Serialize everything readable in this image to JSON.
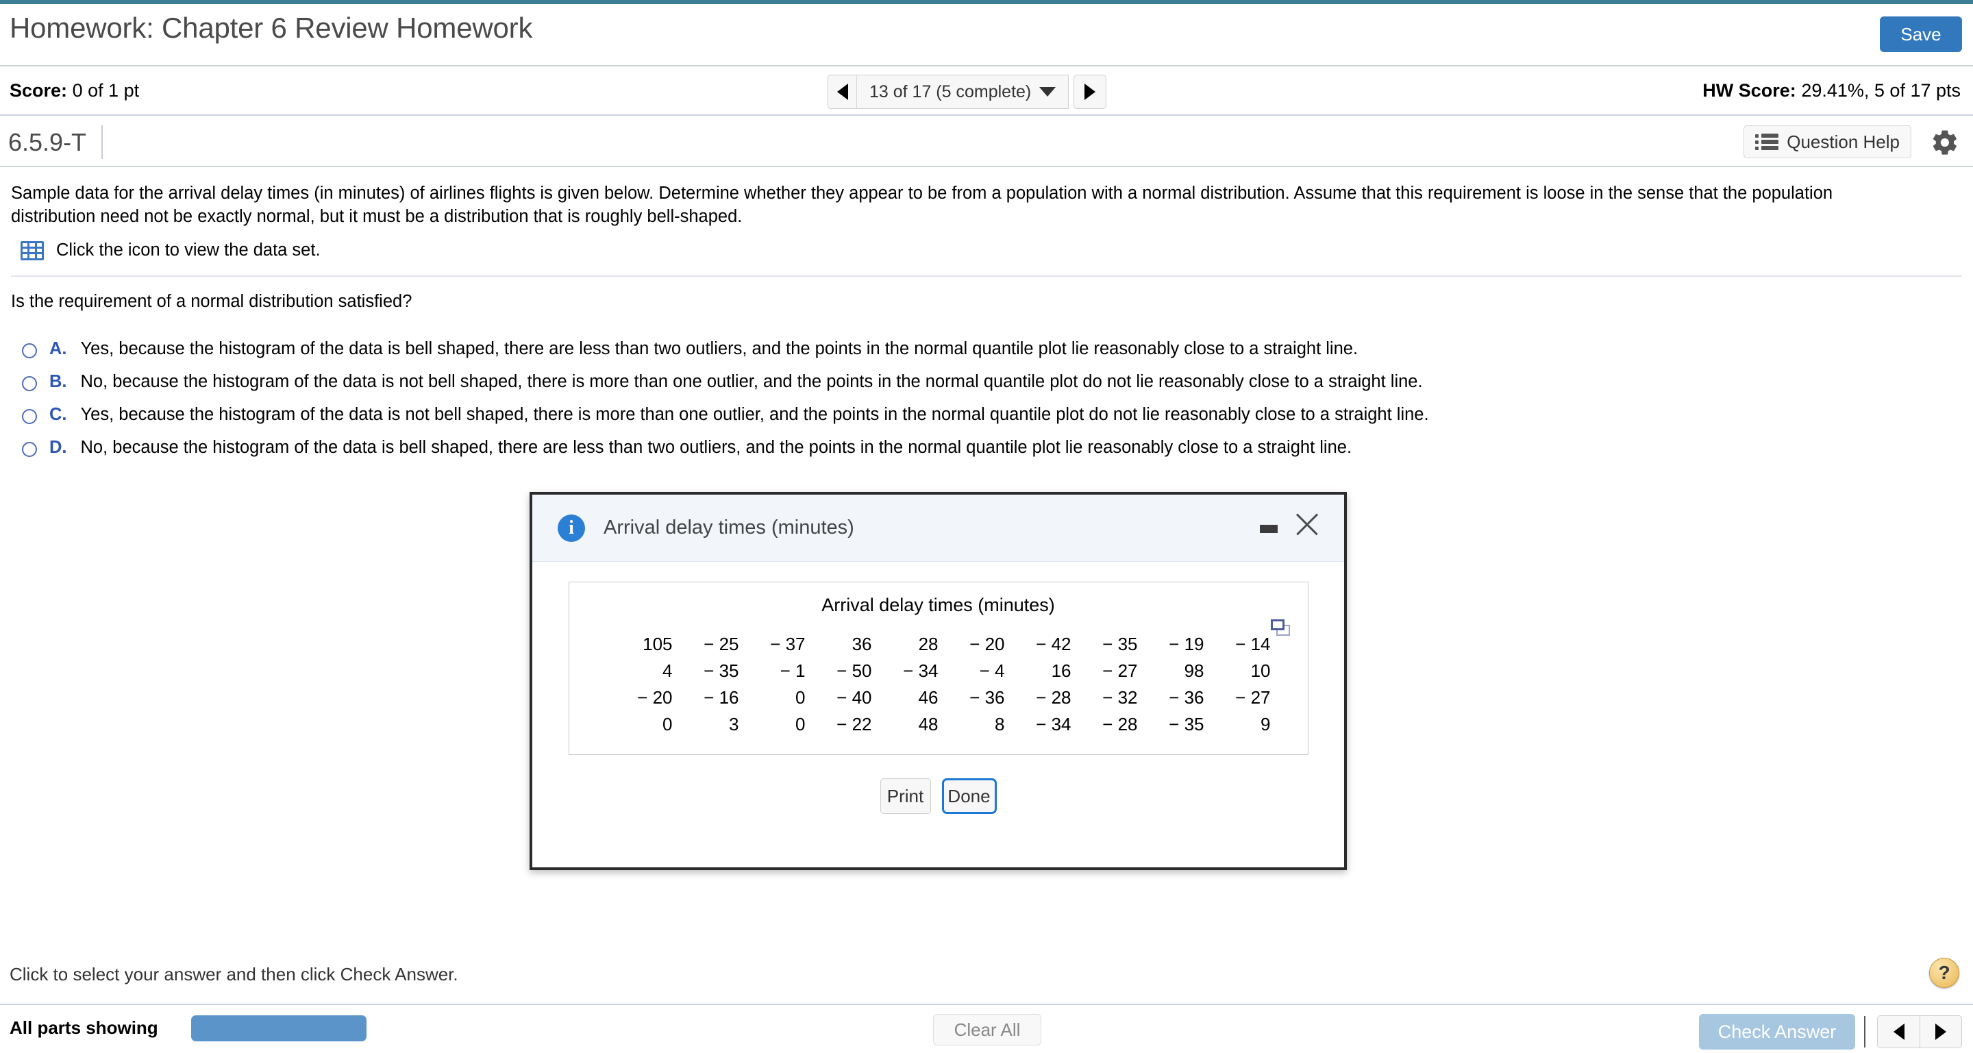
{
  "header": {
    "title": "Homework: Chapter 6 Review Homework",
    "save_label": "Save",
    "accent_color": "#3178bd",
    "strip_color": "#3c7f94"
  },
  "score_bar": {
    "score_label": "Score:",
    "score_value": "0 of 1 pt",
    "pager_text": "13 of 17 (5 complete)",
    "prev_icon": "triangle-left-icon",
    "next_icon": "triangle-right-icon",
    "dropdown_icon": "chevron-down-icon",
    "hw_score_label": "HW Score:",
    "hw_score_value": "29.41%, 5 of 17 pts"
  },
  "exercise_bar": {
    "exercise_id": "6.5.9-T",
    "question_help_label": "Question Help",
    "help_icon": "list-icon",
    "settings_icon": "gear-icon"
  },
  "question": {
    "statement": "Sample data for the arrival delay times (in minutes) of airlines flights is given below. Determine whether they appear to be from a population with a normal distribution. Assume that this requirement is loose in the sense that the population distribution need not be exactly normal, but it must be a distribution that is roughly bell-shaped.",
    "data_link_icon": "grid-table-icon",
    "data_link_text": "Click the icon to view the data set.",
    "prompt": "Is the requirement of a normal distribution satisfied?",
    "choices": [
      {
        "letter": "A.",
        "text": "Yes, because the histogram of the data is bell shaped, there are less than two outliers, and the points in the normal quantile plot lie reasonably close to a straight line.",
        "selected": false
      },
      {
        "letter": "B.",
        "text": "No, because the histogram of the data is not bell shaped, there is more than one outlier, and the points in the normal quantile plot do not lie reasonably close to a straight line.",
        "selected": false
      },
      {
        "letter": "C.",
        "text": "Yes, because the histogram of the data is not bell shaped, there is more than one outlier, and the points in the normal quantile plot do not lie reasonably close to a straight line.",
        "selected": false
      },
      {
        "letter": "D.",
        "text": "No, because the histogram of the data is bell shaped, there are less than two outliers, and the points in the normal quantile plot lie reasonably close to a straight line.",
        "selected": false
      }
    ]
  },
  "modal": {
    "info_icon": "info-icon",
    "title": "Arrival delay times (minutes)",
    "minimize_icon": "minimize-icon",
    "close_icon": "close-icon",
    "card_title": "Arrival delay times (minutes)",
    "copy_icon": "copy-icon",
    "print_label": "Print",
    "done_label": "Done",
    "dataset_rows": [
      [
        "105",
        "− 25",
        "− 37",
        "36",
        "28",
        "− 20",
        "− 42",
        "− 35",
        "− 19",
        "− 14"
      ],
      [
        "4",
        "− 35",
        "− 1",
        "− 50",
        "− 34",
        "− 4",
        "16",
        "− 27",
        "98",
        "10"
      ],
      [
        "− 20",
        "− 16",
        "0",
        "− 40",
        "46",
        "− 36",
        "− 28",
        "− 32",
        "− 36",
        "− 27"
      ],
      [
        "0",
        "3",
        "0",
        "− 22",
        "48",
        "8",
        "− 34",
        "− 28",
        "− 35",
        "9"
      ]
    ]
  },
  "footer": {
    "hint_text": "Click to select your answer and then click Check Answer.",
    "help_icon_label": "?",
    "all_parts_label": "All parts showing",
    "clear_all_label": "Clear All",
    "check_answer_label": "Check Answer",
    "prev_icon": "triangle-left-icon",
    "next_icon": "triangle-right-icon",
    "progress_color": "#5b94c9",
    "check_answer_color": "#a7c6e0"
  }
}
